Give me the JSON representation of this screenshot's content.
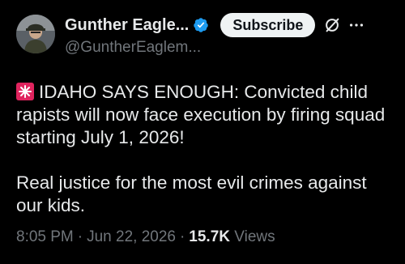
{
  "author": {
    "display_name": "Gunther Eagle...",
    "handle": "@GuntherEaglem...",
    "verified": true,
    "avatar_icon": "person-avatar"
  },
  "actions": {
    "subscribe_label": "Subscribe",
    "grok_icon": "slashed-circle-icon",
    "more_icon": "ellipsis-icon"
  },
  "post": {
    "siren_icon": "siren-emoji",
    "paragraph_1": "IDAHO SAYS ENOUGH: Convicted child rapists will now face execution by firing squad starting July 1, 2026!",
    "paragraph_2": "Real justice for the most evil crimes against our kids."
  },
  "meta": {
    "time": "8:05 PM",
    "separator": "·",
    "date": "Jun 22, 2026",
    "views_count": "15.7K",
    "views_label": "Views"
  },
  "colors": {
    "background": "#000000",
    "text": "#e7e9ea",
    "secondary": "#71767b",
    "verified_badge": "#1d9bf0",
    "subscribe_bg": "#eff3f4",
    "siren_red": "#e0245e"
  }
}
